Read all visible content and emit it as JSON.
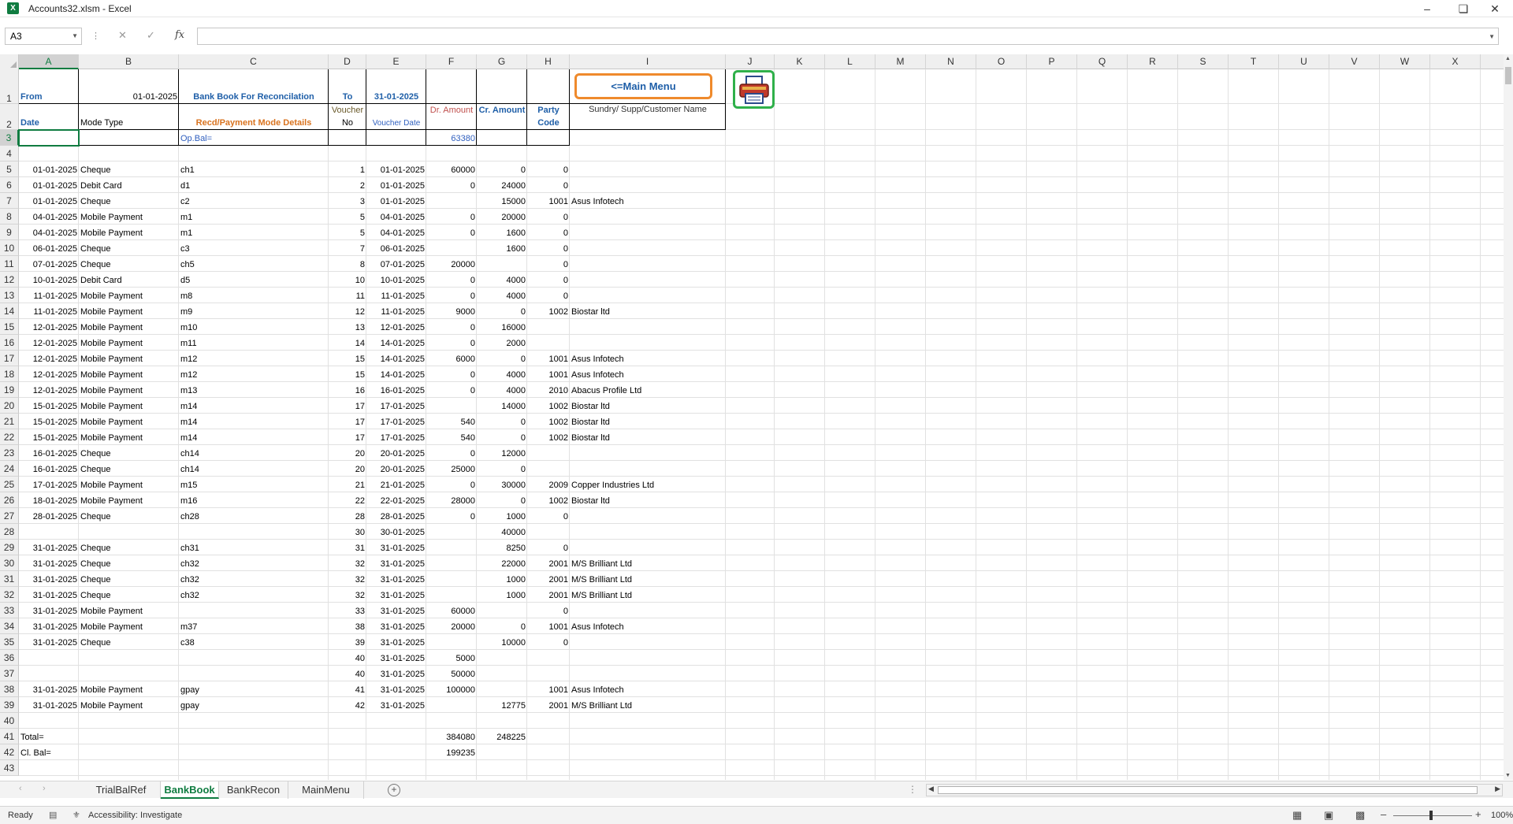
{
  "window": {
    "title": "Accounts32.xlsm - Excel",
    "app_icon": "excel-icon"
  },
  "formula_bar": {
    "name_box": "A3",
    "fx_label": "fx",
    "formula": ""
  },
  "columns": [
    "A",
    "B",
    "C",
    "D",
    "E",
    "F",
    "G",
    "H",
    "I",
    "J",
    "K",
    "L",
    "M",
    "N",
    "O",
    "P",
    "Q",
    "R",
    "S",
    "T",
    "U",
    "V",
    "W",
    "X"
  ],
  "rows": [
    "1",
    "2",
    "3",
    "4",
    "5",
    "6",
    "7",
    "8",
    "9",
    "10",
    "11",
    "12",
    "13",
    "14",
    "15",
    "16",
    "17",
    "18",
    "19",
    "20",
    "21",
    "22",
    "23",
    "24",
    "25",
    "26",
    "27",
    "28",
    "29",
    "30",
    "31",
    "32",
    "33",
    "34",
    "35",
    "36",
    "37",
    "38",
    "39",
    "40",
    "41",
    "42",
    "43"
  ],
  "header": {
    "from_label": "From",
    "from_date": "01-01-2025",
    "title": "Bank Book For Reconcilation",
    "to_label": "To",
    "to_date": "31-01-2025",
    "date": "Date",
    "mode_type": "Mode Type",
    "mode_details": "Recd/Payment Mode Details",
    "voucher_no_1": "Voucher",
    "voucher_no_2": "No",
    "voucher_date": "Voucher Date",
    "dr_amount": "Dr. Amount",
    "cr_amount": "Cr. Amount",
    "party_code_1": "Party",
    "party_code_2": "Code",
    "party_name": "Sundry/ Supp/Customer Name",
    "op_bal_label": "Op.Bal=",
    "op_bal_value": "63380"
  },
  "buttons": {
    "main_menu": "<=Main Menu",
    "print_icon": "printer-icon"
  },
  "ledger": [
    {
      "row": 5,
      "date": "01-01-2025",
      "mode": "Cheque",
      "detail": "ch1",
      "vno": "1",
      "vdate": "01-01-2025",
      "dr": "60000",
      "cr": "0",
      "code": "0",
      "name": ""
    },
    {
      "row": 6,
      "date": "01-01-2025",
      "mode": "Debit Card",
      "detail": "d1",
      "vno": "2",
      "vdate": "01-01-2025",
      "dr": "0",
      "cr": "24000",
      "code": "0",
      "name": ""
    },
    {
      "row": 7,
      "date": "01-01-2025",
      "mode": "Cheque",
      "detail": "c2",
      "vno": "3",
      "vdate": "01-01-2025",
      "dr": "",
      "cr": "15000",
      "code": "1001",
      "name": "Asus Infotech"
    },
    {
      "row": 8,
      "date": "04-01-2025",
      "mode": "Mobile Payment",
      "detail": "m1",
      "vno": "5",
      "vdate": "04-01-2025",
      "dr": "0",
      "cr": "20000",
      "code": "0",
      "name": ""
    },
    {
      "row": 9,
      "date": "04-01-2025",
      "mode": "Mobile Payment",
      "detail": "m1",
      "vno": "5",
      "vdate": "04-01-2025",
      "dr": "0",
      "cr": "1600",
      "code": "0",
      "name": ""
    },
    {
      "row": 10,
      "date": "06-01-2025",
      "mode": "Cheque",
      "detail": "c3",
      "vno": "7",
      "vdate": "06-01-2025",
      "dr": "",
      "cr": "1600",
      "code": "0",
      "name": ""
    },
    {
      "row": 11,
      "date": "07-01-2025",
      "mode": "Cheque",
      "detail": "ch5",
      "vno": "8",
      "vdate": "07-01-2025",
      "dr": "20000",
      "cr": "",
      "code": "0",
      "name": ""
    },
    {
      "row": 12,
      "date": "10-01-2025",
      "mode": "Debit Card",
      "detail": "d5",
      "vno": "10",
      "vdate": "10-01-2025",
      "dr": "0",
      "cr": "4000",
      "code": "0",
      "name": ""
    },
    {
      "row": 13,
      "date": "11-01-2025",
      "mode": "Mobile Payment",
      "detail": "m8",
      "vno": "11",
      "vdate": "11-01-2025",
      "dr": "0",
      "cr": "4000",
      "code": "0",
      "name": ""
    },
    {
      "row": 14,
      "date": "11-01-2025",
      "mode": "Mobile Payment",
      "detail": "m9",
      "vno": "12",
      "vdate": "11-01-2025",
      "dr": "9000",
      "cr": "0",
      "code": "1002",
      "name": "Biostar ltd"
    },
    {
      "row": 15,
      "date": "12-01-2025",
      "mode": "Mobile Payment",
      "detail": "m10",
      "vno": "13",
      "vdate": "12-01-2025",
      "dr": "0",
      "cr": "16000",
      "code": "",
      "name": ""
    },
    {
      "row": 16,
      "date": "12-01-2025",
      "mode": "Mobile Payment",
      "detail": "m11",
      "vno": "14",
      "vdate": "14-01-2025",
      "dr": "0",
      "cr": "2000",
      "code": "",
      "name": ""
    },
    {
      "row": 17,
      "date": "12-01-2025",
      "mode": "Mobile Payment",
      "detail": "m12",
      "vno": "15",
      "vdate": "14-01-2025",
      "dr": "6000",
      "cr": "0",
      "code": "1001",
      "name": "Asus Infotech"
    },
    {
      "row": 18,
      "date": "12-01-2025",
      "mode": "Mobile Payment",
      "detail": "m12",
      "vno": "15",
      "vdate": "14-01-2025",
      "dr": "0",
      "cr": "4000",
      "code": "1001",
      "name": "Asus Infotech"
    },
    {
      "row": 19,
      "date": "12-01-2025",
      "mode": "Mobile Payment",
      "detail": "m13",
      "vno": "16",
      "vdate": "16-01-2025",
      "dr": "0",
      "cr": "4000",
      "code": "2010",
      "name": "Abacus Profile Ltd"
    },
    {
      "row": 20,
      "date": "15-01-2025",
      "mode": "Mobile Payment",
      "detail": "m14",
      "vno": "17",
      "vdate": "17-01-2025",
      "dr": "",
      "cr": "14000",
      "code": "1002",
      "name": "Biostar ltd"
    },
    {
      "row": 21,
      "date": "15-01-2025",
      "mode": "Mobile Payment",
      "detail": "m14",
      "vno": "17",
      "vdate": "17-01-2025",
      "dr": "540",
      "cr": "0",
      "code": "1002",
      "name": "Biostar ltd"
    },
    {
      "row": 22,
      "date": "15-01-2025",
      "mode": "Mobile Payment",
      "detail": "m14",
      "vno": "17",
      "vdate": "17-01-2025",
      "dr": "540",
      "cr": "0",
      "code": "1002",
      "name": "Biostar ltd"
    },
    {
      "row": 23,
      "date": "16-01-2025",
      "mode": "Cheque",
      "detail": "ch14",
      "vno": "20",
      "vdate": "20-01-2025",
      "dr": "0",
      "cr": "12000",
      "code": "",
      "name": ""
    },
    {
      "row": 24,
      "date": "16-01-2025",
      "mode": "Cheque",
      "detail": "ch14",
      "vno": "20",
      "vdate": "20-01-2025",
      "dr": "25000",
      "cr": "0",
      "code": "",
      "name": ""
    },
    {
      "row": 25,
      "date": "17-01-2025",
      "mode": "Mobile Payment",
      "detail": "m15",
      "vno": "21",
      "vdate": "21-01-2025",
      "dr": "0",
      "cr": "30000",
      "code": "2009",
      "name": "Copper Industries Ltd"
    },
    {
      "row": 26,
      "date": "18-01-2025",
      "mode": "Mobile Payment",
      "detail": "m16",
      "vno": "22",
      "vdate": "22-01-2025",
      "dr": "28000",
      "cr": "0",
      "code": "1002",
      "name": "Biostar ltd"
    },
    {
      "row": 27,
      "date": "28-01-2025",
      "mode": "Cheque",
      "detail": "ch28",
      "vno": "28",
      "vdate": "28-01-2025",
      "dr": "0",
      "cr": "1000",
      "code": "0",
      "name": ""
    },
    {
      "row": 28,
      "date": "",
      "mode": "",
      "detail": "",
      "vno": "30",
      "vdate": "30-01-2025",
      "dr": "",
      "cr": "40000",
      "code": "",
      "name": ""
    },
    {
      "row": 29,
      "date": "31-01-2025",
      "mode": "Cheque",
      "detail": "ch31",
      "vno": "31",
      "vdate": "31-01-2025",
      "dr": "",
      "cr": "8250",
      "code": "0",
      "name": ""
    },
    {
      "row": 30,
      "date": "31-01-2025",
      "mode": "Cheque",
      "detail": "ch32",
      "vno": "32",
      "vdate": "31-01-2025",
      "dr": "",
      "cr": "22000",
      "code": "2001",
      "name": "M/S Brilliant Ltd"
    },
    {
      "row": 31,
      "date": "31-01-2025",
      "mode": "Cheque",
      "detail": "ch32",
      "vno": "32",
      "vdate": "31-01-2025",
      "dr": "",
      "cr": "1000",
      "code": "2001",
      "name": "M/S Brilliant Ltd"
    },
    {
      "row": 32,
      "date": "31-01-2025",
      "mode": "Cheque",
      "detail": "ch32",
      "vno": "32",
      "vdate": "31-01-2025",
      "dr": "",
      "cr": "1000",
      "code": "2001",
      "name": "M/S Brilliant Ltd"
    },
    {
      "row": 33,
      "date": "31-01-2025",
      "mode": "Mobile Payment",
      "detail": "",
      "vno": "33",
      "vdate": "31-01-2025",
      "dr": "60000",
      "cr": "",
      "code": "0",
      "name": ""
    },
    {
      "row": 34,
      "date": "31-01-2025",
      "mode": "Mobile Payment",
      "detail": "m37",
      "vno": "38",
      "vdate": "31-01-2025",
      "dr": "20000",
      "cr": "0",
      "code": "1001",
      "name": "Asus Infotech"
    },
    {
      "row": 35,
      "date": "31-01-2025",
      "mode": "Cheque",
      "detail": "c38",
      "vno": "39",
      "vdate": "31-01-2025",
      "dr": "",
      "cr": "10000",
      "code": "0",
      "name": ""
    },
    {
      "row": 36,
      "date": "",
      "mode": "",
      "detail": "",
      "vno": "40",
      "vdate": "31-01-2025",
      "dr": "5000",
      "cr": "",
      "code": "",
      "name": ""
    },
    {
      "row": 37,
      "date": "",
      "mode": "",
      "detail": "",
      "vno": "40",
      "vdate": "31-01-2025",
      "dr": "50000",
      "cr": "",
      "code": "",
      "name": ""
    },
    {
      "row": 38,
      "date": "31-01-2025",
      "mode": "Mobile Payment",
      "detail": "gpay",
      "vno": "41",
      "vdate": "31-01-2025",
      "dr": "100000",
      "cr": "",
      "code": "1001",
      "name": "Asus Infotech"
    },
    {
      "row": 39,
      "date": "31-01-2025",
      "mode": "Mobile Payment",
      "detail": "gpay",
      "vno": "42",
      "vdate": "31-01-2025",
      "dr": "",
      "cr": "12775",
      "code": "2001",
      "name": "M/S Brilliant Ltd"
    }
  ],
  "totals": {
    "total_label": "Total=",
    "total_dr": "384080",
    "total_cr": "248225",
    "cl_bal_label": "Cl. Bal=",
    "cl_bal_value": "199235"
  },
  "sheet_tabs": [
    "TrialBalRef",
    "BankBook",
    "BankRecon",
    "MainMenu"
  ],
  "active_tab": "BankBook",
  "status": {
    "ready": "Ready",
    "accessibility": "Accessibility: Investigate",
    "zoom": "100%"
  }
}
